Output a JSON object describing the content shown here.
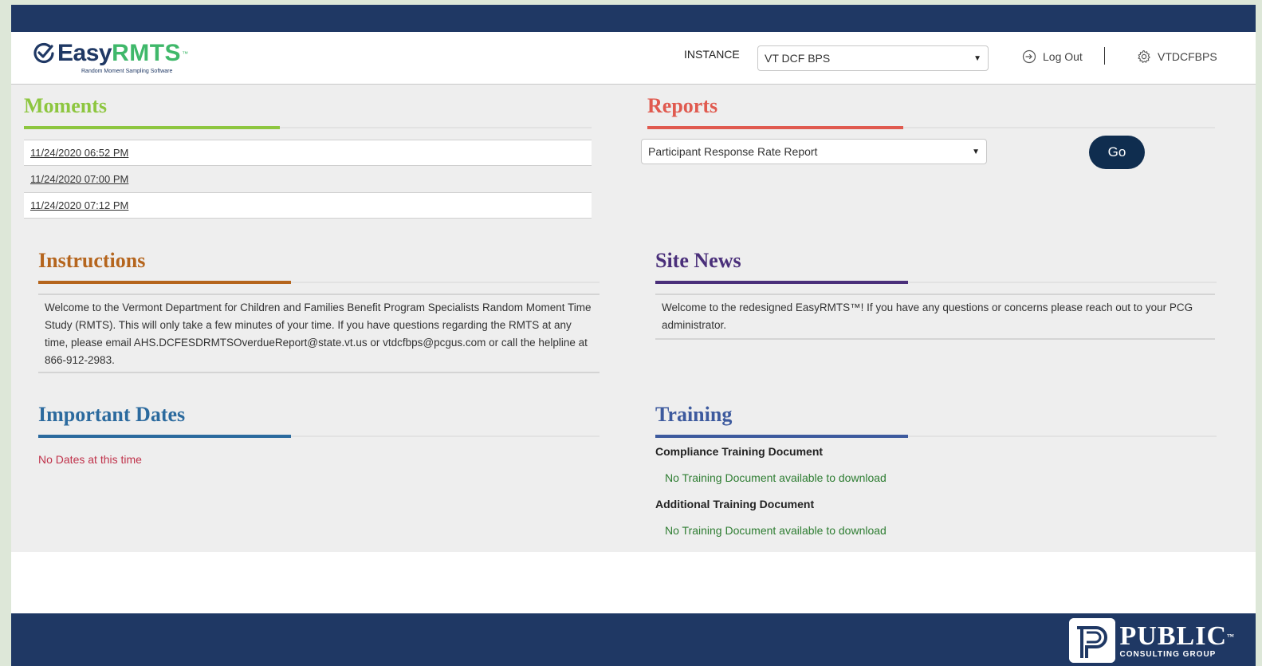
{
  "colors": {
    "navy": "#1f3864",
    "moments": "#8dc63f",
    "reports": "#e05a4f",
    "instructions": "#b5651d",
    "site_news": "#4a2f7a",
    "important_dates": "#2b6a9e",
    "training": "#3d5a9e",
    "go_button": "#0f2d4f"
  },
  "header": {
    "logo_easy": "Easy",
    "logo_rmts": "RMTS",
    "logo_tm": "™",
    "logo_tagline": "Random Moment Sampling Software",
    "instance_label": "INSTANCE",
    "instance_value": "VT DCF BPS",
    "logout_label": "Log Out",
    "user_label": "VTDCFBPS"
  },
  "moments": {
    "title": "Moments",
    "items": [
      "11/24/2020 06:52 PM",
      "11/24/2020 07:00 PM",
      "11/24/2020 07:12 PM"
    ]
  },
  "reports": {
    "title": "Reports",
    "selected": "Participant Response Rate Report",
    "go_label": "Go"
  },
  "instructions": {
    "title": "Instructions",
    "body": "Welcome to the Vermont Department for Children and Families Benefit Program Specialists Random Moment Time Study (RMTS). This will only take a few minutes of your time.  If you have questions regarding the RMTS at any time, please email AHS.DCFESDRMTSOverdueReport@state.vt.us or vtdcfbps@pcgus.com or call the helpline at 866-912-2983."
  },
  "site_news": {
    "title": "Site News",
    "body": "Welcome to the redesigned EasyRMTS™!  If you have any questions or concerns please reach out to your PCG administrator."
  },
  "important_dates": {
    "title": "Important Dates",
    "empty": "No Dates at this time"
  },
  "training": {
    "title": "Training",
    "compliance_label": "Compliance Training Document",
    "compliance_msg": "No Training Document available to download",
    "additional_label": "Additional Training Document",
    "additional_msg": "No Training Document available to download"
  },
  "footer": {
    "pcg_public": "PUBLIC",
    "pcg_sub": "CONSULTING GROUP",
    "pcg_tm": "™"
  }
}
